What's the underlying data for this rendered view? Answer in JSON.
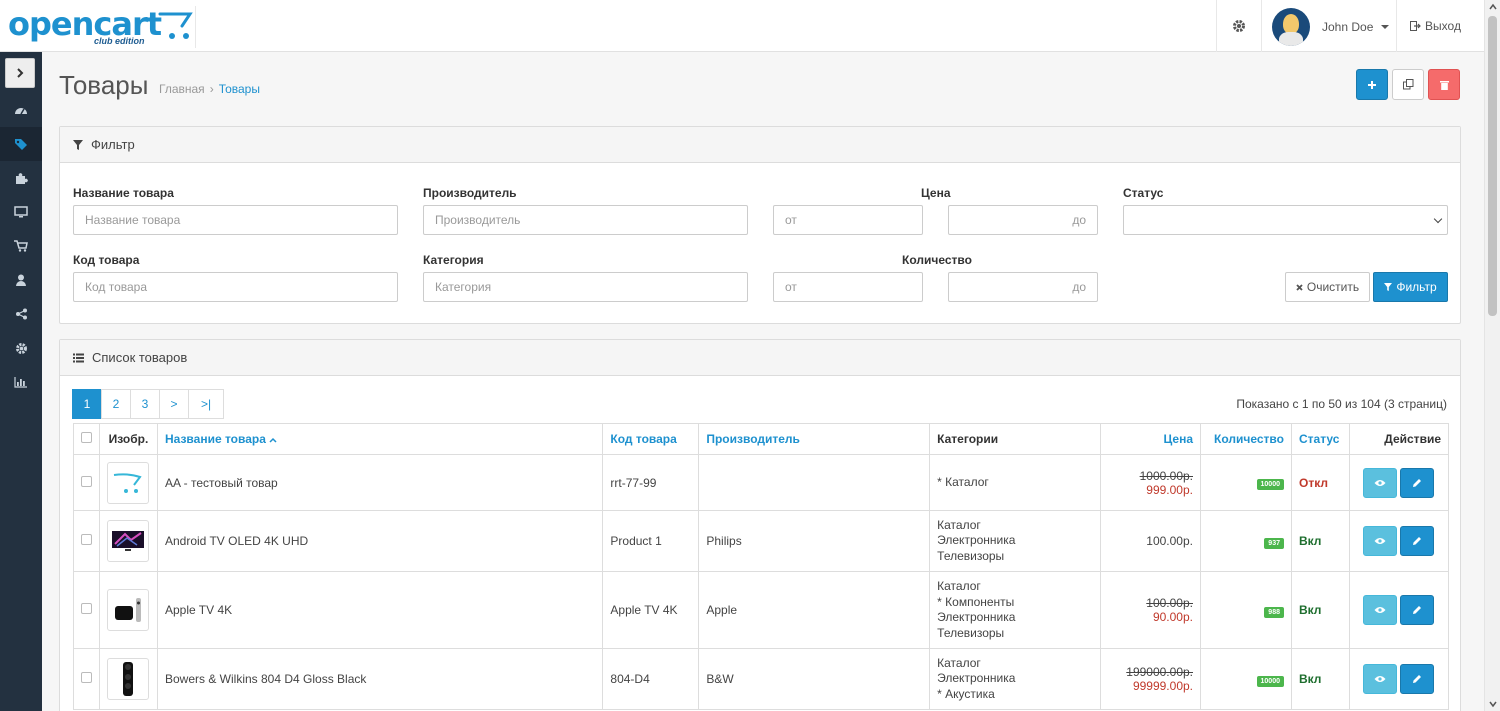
{
  "header": {
    "logo_text": "opencart",
    "logo_sub": "club edition",
    "user_name": "John Doe",
    "logout_label": "Выход"
  },
  "sidebar": {
    "items": [
      "dashboard-icon",
      "tags-icon",
      "puzzle-icon",
      "desktop-icon",
      "cart-icon",
      "user-icon",
      "share-icon",
      "gear-icon",
      "bar-chart-icon"
    ],
    "active_index": 1
  },
  "page": {
    "title": "Товары",
    "breadcrumb": [
      "Главная",
      "Товары"
    ]
  },
  "filter": {
    "heading": "Фильтр",
    "name_label": "Название товара",
    "name_placeholder": "Название товара",
    "manufacturer_label": "Производитель",
    "manufacturer_placeholder": "Производитель",
    "price_label": "Цена",
    "price_from": "от",
    "price_to": "до",
    "status_label": "Статус",
    "model_label": "Код товара",
    "model_placeholder": "Код товара",
    "category_label": "Категория",
    "category_placeholder": "Категория",
    "quantity_label": "Количество",
    "quantity_from": "от",
    "quantity_to": "до",
    "clear_label": "Очистить",
    "filter_label": "Фильтр"
  },
  "list": {
    "heading": "Список товаров",
    "pages": [
      "1",
      "2",
      "3",
      ">",
      ">|"
    ],
    "active_page": "1",
    "info": "Показано с 1 по 50 из 104 (3 страниц)",
    "columns": {
      "image": "Изобр.",
      "name": "Название товара",
      "model": "Код товара",
      "manufacturer": "Производитель",
      "categories": "Категории",
      "price": "Цена",
      "quantity": "Количество",
      "status": "Статус",
      "action": "Действие"
    },
    "rows": [
      {
        "name": "AA - тестовый товар",
        "model": "rrt-77-99",
        "manufacturer": "",
        "categories": [
          "* Каталог"
        ],
        "price": "1000.00р.",
        "special": "999.00р.",
        "quantity": "10000",
        "status": "Откл",
        "status_on": false,
        "image": "opencart-logo"
      },
      {
        "name": "Android TV OLED 4K UHD",
        "model": "Product 1",
        "manufacturer": "Philips",
        "categories": [
          "Каталог",
          "Электронника",
          "Телевизоры"
        ],
        "price": "100.00р.",
        "special": "",
        "quantity": "937",
        "status": "Вкл",
        "status_on": true,
        "image": "tv"
      },
      {
        "name": "Apple TV 4K",
        "model": "Apple TV 4K",
        "manufacturer": "Apple",
        "categories": [
          "Каталог",
          "* Компоненты",
          "Электронника",
          "Телевизоры"
        ],
        "price": "100.00р.",
        "special": "90.00р.",
        "quantity": "988",
        "status": "Вкл",
        "status_on": true,
        "image": "apple-tv"
      },
      {
        "name": "Bowers & Wilkins 804 D4 Gloss Black",
        "model": "804-D4",
        "manufacturer": "B&W",
        "categories": [
          "Каталог",
          "Электронника",
          "* Акустика"
        ],
        "price": "199000.00р.",
        "special": "99999.00р.",
        "quantity": "10000",
        "status": "Вкл",
        "status_on": true,
        "image": "speaker"
      }
    ]
  }
}
